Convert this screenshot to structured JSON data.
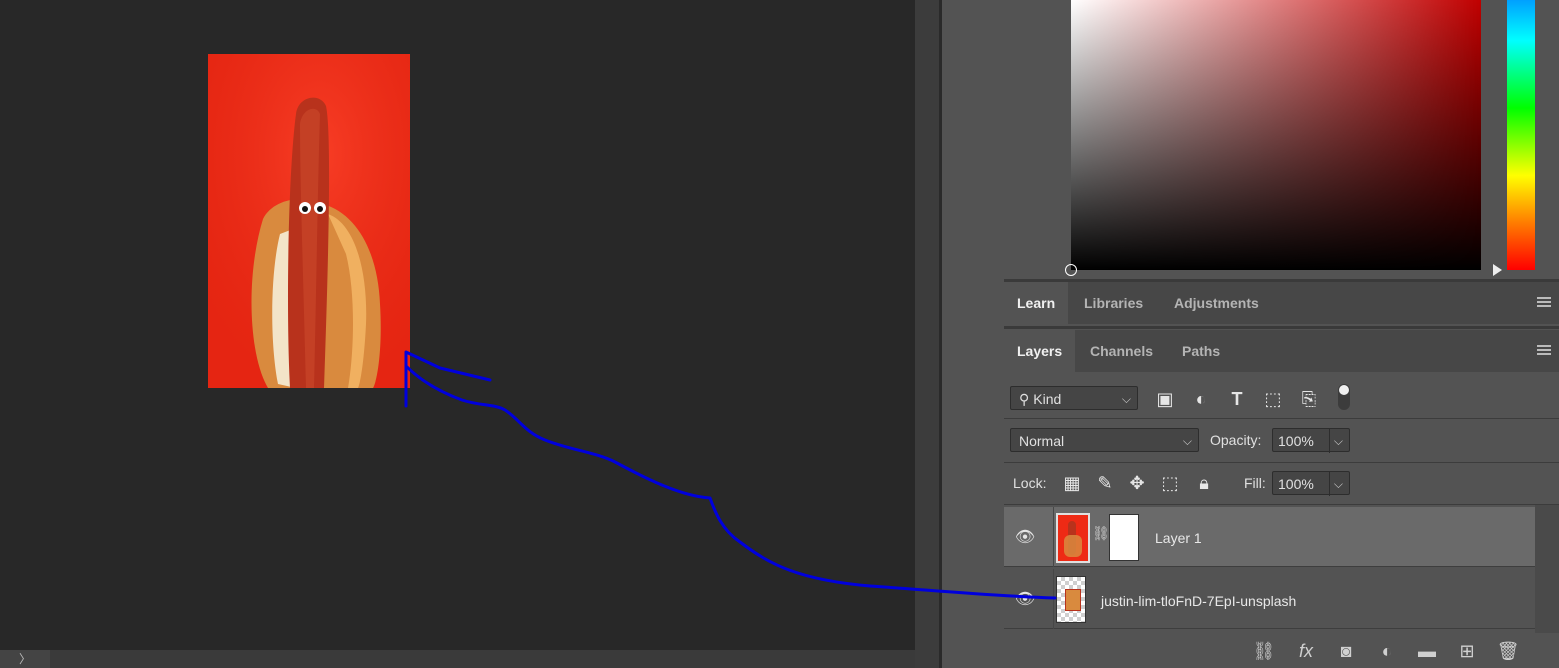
{
  "panels": {
    "learn_tabs": [
      "Learn",
      "Libraries",
      "Adjustments"
    ],
    "layers_tabs": [
      "Layers",
      "Channels",
      "Paths"
    ]
  },
  "filter": {
    "kind_label": "Kind",
    "icons": [
      "image-filter-icon",
      "adjustment-filter-icon",
      "type-filter-icon",
      "shape-filter-icon",
      "smart-object-filter-icon"
    ]
  },
  "blend": {
    "mode": "Normal",
    "opacity_label": "Opacity:",
    "opacity_value": "100%",
    "lock_label": "Lock:",
    "fill_label": "Fill:",
    "fill_value": "100%"
  },
  "layers": [
    {
      "name": "Layer 1",
      "selected": true
    },
    {
      "name": "justin-lim-tloFnD-7EpI-unsplash",
      "selected": false
    }
  ],
  "bottom_strip": {
    "toggle": "〉"
  },
  "colors": {
    "annotation": "#0000dd",
    "panel_bg": "#535353"
  }
}
